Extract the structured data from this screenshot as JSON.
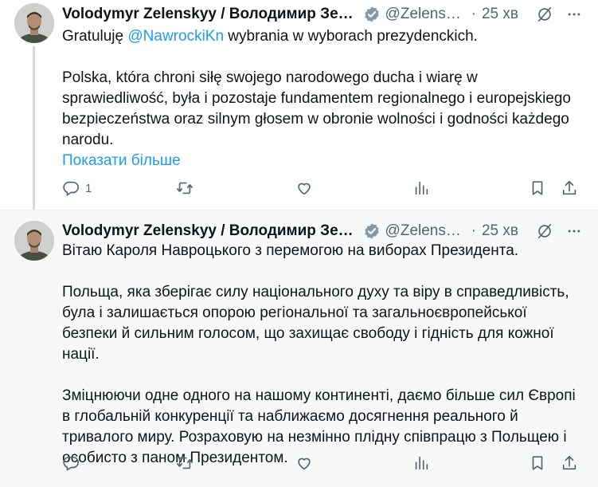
{
  "tweets": [
    {
      "author": {
        "name": "Volodymyr Zelenskyy / Володимир Зеле…",
        "handle": "@Zelensk…",
        "avatar_icon": "zelenskyy-avatar"
      },
      "separator": "·",
      "time": "25 хв",
      "body": {
        "line1_prefix": "Gratuluję ",
        "mention": "@NawrockiKn",
        "line1_suffix": " wybrania w wyborach prezydenckich.",
        "paragraph2": "Polska, która chroni siłę swojego narodowego ducha i wiarę w sprawiedliwość, była i pozostaje fundamentem regionalnego i europejskiego bezpieczeństwa oraz silnym głosem w obronie wolności i godności każdego narodu."
      },
      "show_more": "Показати більше",
      "actions": {
        "reply_count": "1",
        "retweet_count": "",
        "like_count": "",
        "views_count": ""
      }
    },
    {
      "author": {
        "name": "Volodymyr Zelenskyy / Володимир Зеле…",
        "handle": "@Zelensk…",
        "avatar_icon": "zelenskyy-avatar"
      },
      "separator": "·",
      "time": "25 хв",
      "body": {
        "paragraph1": "Вітаю Кароля Навроцького з перемогою на виборах Президента.",
        "paragraph2": "Польща, яка зберігає силу національного духу та віру в справедливість, була і залишається опорою регіональної та загальноєвропейської безпеки й сильним голосом, що захищає свободу і гідність для кожної нації.",
        "paragraph3": "Зміцнюючи одне одного на нашому континенті, даємо більше сил Європі в глобальній конкуренції та наближаємо досягнення реального й тривалого миру. Розраховую на незмінно плідну співпрацю з Польщею і особисто з паном Президентом."
      },
      "actions": {
        "reply_count": "",
        "retweet_count": "",
        "like_count": "",
        "views_count": ""
      }
    }
  ],
  "colors": {
    "link": "#1d9bf0",
    "verified": "#829aab",
    "muted": "#536471",
    "text": "#0f1419",
    "thread_line": "#cfd9de",
    "second_bg": "#f7f9f9"
  },
  "icons": [
    "verified-badge-icon",
    "grok-icon",
    "more-icon",
    "reply-icon",
    "retweet-icon",
    "like-icon",
    "views-icon",
    "bookmark-icon",
    "share-icon"
  ]
}
